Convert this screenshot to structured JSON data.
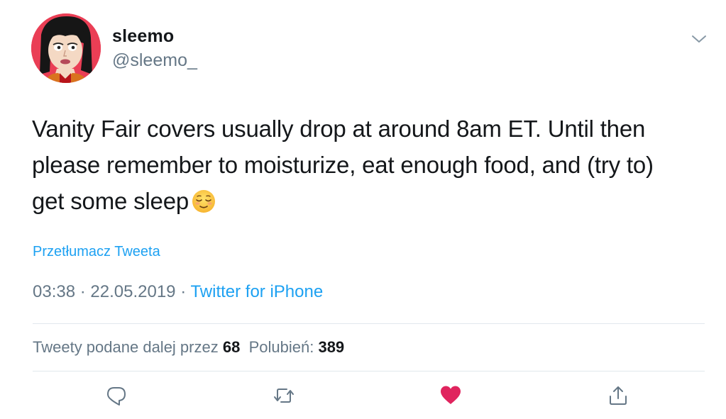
{
  "user": {
    "display_name": "sleemo",
    "handle": "@sleemo_",
    "avatar_icon": "cartoon-girl-avatar-icon"
  },
  "tweet": {
    "lines": [
      "Vanity Fair covers usually drop at around 8am ET. Until then",
      "please remember to moisturize, eat enough food, and (try to)",
      "get some sleep"
    ],
    "emoji": "relieved-face-emoji",
    "translate_label": "Przetłumacz Tweeta",
    "time": "03:38",
    "separator": "·",
    "date": "22.05.2019",
    "source": "Twitter for iPhone"
  },
  "stats": {
    "retweets_label": "Tweety podane dalej przez",
    "retweets_count": "68",
    "likes_label": "Polubień:",
    "likes_count": "389"
  },
  "actions": {
    "reply_icon": "reply-icon",
    "retweet_icon": "retweet-icon",
    "like_icon": "heart-icon",
    "share_icon": "share-icon",
    "liked": true
  },
  "colors": {
    "accent": "#1da1f2",
    "like": "#e0245e",
    "muted": "#657786",
    "text": "#14171a",
    "divider": "#e1e8ed"
  }
}
